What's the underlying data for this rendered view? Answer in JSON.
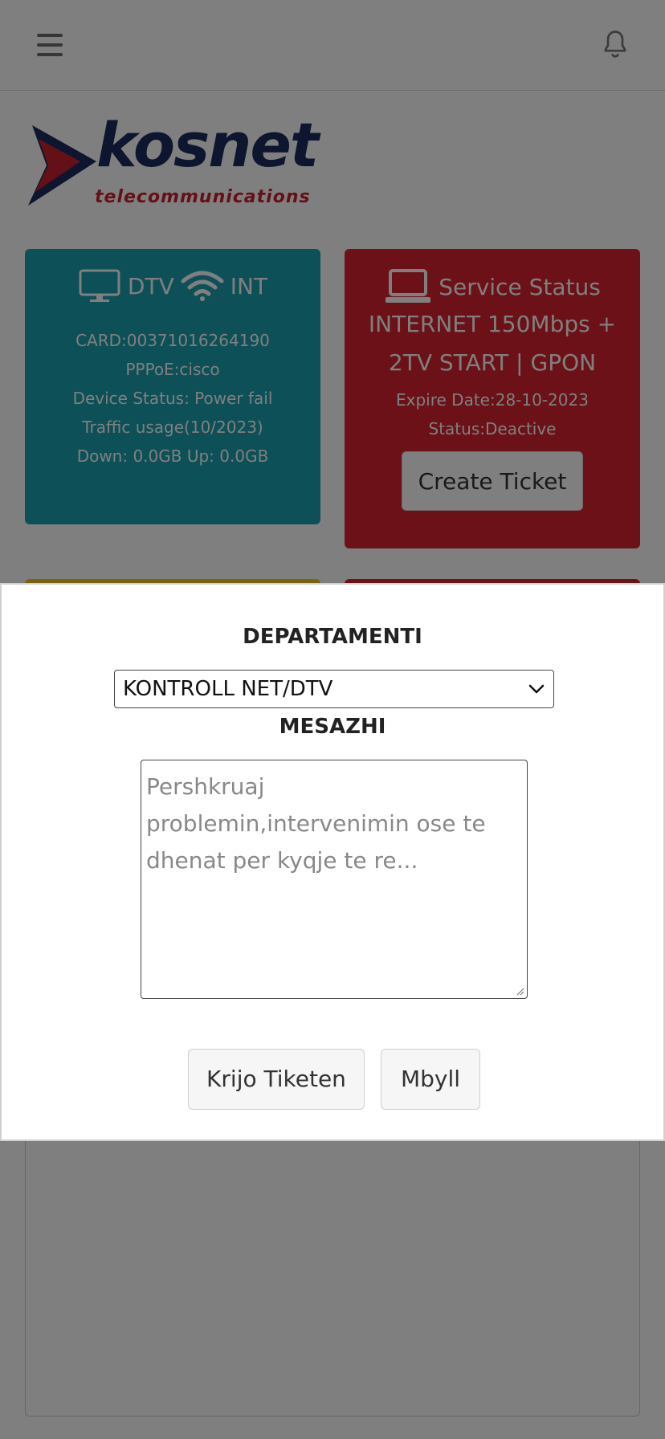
{
  "header": {
    "menu_icon": "hamburger-menu-icon",
    "notification_icon": "bell-icon"
  },
  "brand": {
    "name": "kosnet",
    "tagline": "telecommunications",
    "colors": {
      "navy": "#1c2b5e",
      "red": "#c8202f"
    }
  },
  "cards": {
    "subscription": {
      "tv_label": "DTV",
      "int_label": "INT",
      "lines": [
        "CARD:00371016264190",
        "PPPoE:cisco",
        "Device Status: Power fail",
        "Traffic usage(10/2023)",
        "Down: 0.0GB Up: 0.0GB"
      ],
      "color": "#1aa1b0"
    },
    "service": {
      "title": "Service Status",
      "plan_line1": "INTERNET 150Mbps +",
      "plan_line2": "2TV START | GPON",
      "expire": "Expire Date:28-10-2023",
      "status": "Status:Deactive",
      "create_ticket": "Create Ticket",
      "color": "#d9232f"
    }
  },
  "modal": {
    "department_label": "DEPARTAMENTI",
    "department_value": "KONTROLL NET/DTV",
    "message_label": "MESAZHI",
    "message_placeholder": "Pershkruaj problemin,intervenimin ose te dhenat per kyqje te re...",
    "create_button": "Krijo Tiketen",
    "close_button": "Mbyll"
  }
}
